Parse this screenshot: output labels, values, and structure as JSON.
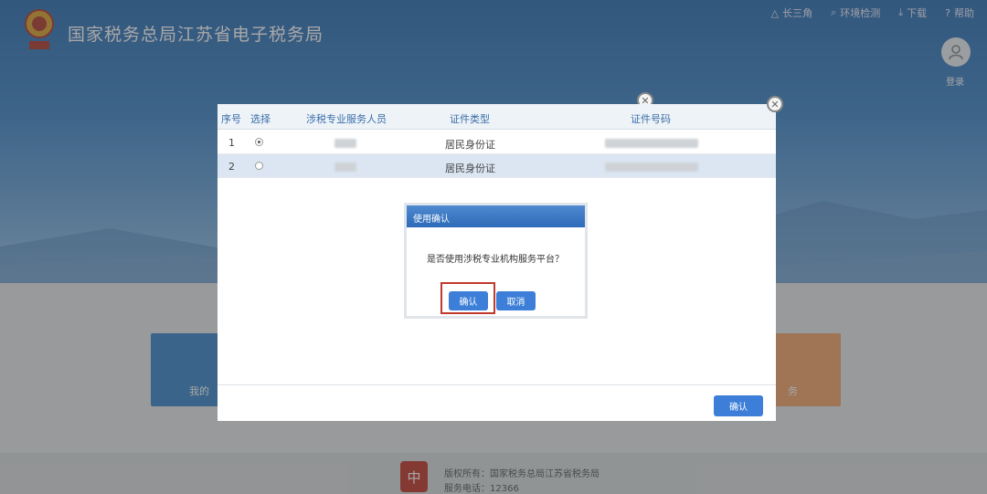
{
  "header": {
    "site_title": "国家税务总局江苏省电子税务局",
    "links": [
      {
        "icon": "triangle-icon",
        "label": "长三角"
      },
      {
        "icon": "monitor-icon",
        "label": "环境检测"
      },
      {
        "icon": "download-icon",
        "label": "下载"
      },
      {
        "icon": "help-icon",
        "label": "帮助"
      }
    ],
    "login_label": "登录"
  },
  "background_tiles": {
    "left_text": "我的",
    "right_text": "务"
  },
  "footer": {
    "copyright": "版权所有：国家税务总局江苏省税务局",
    "phone": "服务电话：12366"
  },
  "dialog": {
    "columns": [
      "序号",
      "选择",
      "涉税专业服务人员",
      "证件类型",
      "证件号码"
    ],
    "rows": [
      {
        "index": "1",
        "selected": true,
        "id_type": "居民身份证"
      },
      {
        "index": "2",
        "selected": false,
        "id_type": "居民身份证"
      }
    ],
    "confirm_button": "确认"
  },
  "confirm_popup": {
    "title": "使用确认",
    "message": "是否使用涉税专业机构服务平台？",
    "ok": "确认",
    "cancel": "取消"
  },
  "colors": {
    "accent": "#3d7fd8",
    "highlight": "#c0392b"
  }
}
